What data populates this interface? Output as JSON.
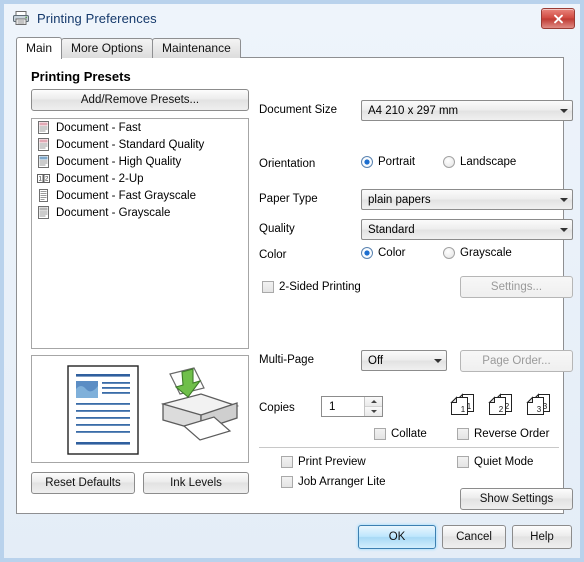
{
  "window": {
    "title": "Printing Preferences",
    "title_icon": "printer-icon",
    "close_label": "x",
    "accent_color": "#b9d2ec",
    "close_color": "#bf3a32"
  },
  "tabs": [
    {
      "label": "Main",
      "active": true
    },
    {
      "label": "More Options",
      "active": false
    },
    {
      "label": "Maintenance",
      "active": false
    }
  ],
  "presets": {
    "heading": "Printing Presets",
    "add_remove_label": "Add/Remove Presets...",
    "items": [
      {
        "label": "Document - Fast",
        "icon": "document-preset-icon"
      },
      {
        "label": "Document - Standard Quality",
        "icon": "document-preset-icon"
      },
      {
        "label": "Document - High Quality",
        "icon": "document-preset-icon"
      },
      {
        "label": "Document - 2-Up",
        "icon": "two-up-icon"
      },
      {
        "label": "Document - Fast Grayscale",
        "icon": "document-gray-icon"
      },
      {
        "label": "Document - Grayscale",
        "icon": "document-gray-icon"
      }
    ]
  },
  "preview": {
    "page_icon": "document-page-preview",
    "printer_icon": "printer-output-icon"
  },
  "left_buttons": {
    "reset_defaults": "Reset Defaults",
    "ink_levels": "Ink Levels"
  },
  "settings": {
    "document_size": {
      "label": "Document Size",
      "value": "A4 210 x 297 mm"
    },
    "orientation": {
      "label": "Orientation",
      "options": [
        "Portrait",
        "Landscape"
      ],
      "selected": "Portrait"
    },
    "paper_type": {
      "label": "Paper Type",
      "value": "plain papers"
    },
    "quality": {
      "label": "Quality",
      "value": "Standard"
    },
    "color": {
      "label": "Color",
      "options": [
        "Color",
        "Grayscale"
      ],
      "selected": "Color"
    },
    "two_sided": {
      "label": "2-Sided Printing",
      "checked": false,
      "settings_button": "Settings...",
      "settings_enabled": false
    },
    "multi_page": {
      "label": "Multi-Page",
      "value": "Off",
      "page_order_button": "Page Order...",
      "page_order_enabled": false
    },
    "copies": {
      "label": "Copies",
      "value": "1",
      "page_numbers": [
        "1",
        "2",
        "3"
      ],
      "collate": {
        "label": "Collate",
        "checked": false
      },
      "reverse_order": {
        "label": "Reverse Order",
        "checked": false
      }
    },
    "print_preview": {
      "label": "Print Preview",
      "checked": false
    },
    "job_arranger": {
      "label": "Job Arranger Lite",
      "checked": false
    },
    "quiet_mode": {
      "label": "Quiet Mode",
      "checked": false
    },
    "show_settings": "Show Settings"
  },
  "footer": {
    "ok": "OK",
    "cancel": "Cancel",
    "help": "Help"
  }
}
